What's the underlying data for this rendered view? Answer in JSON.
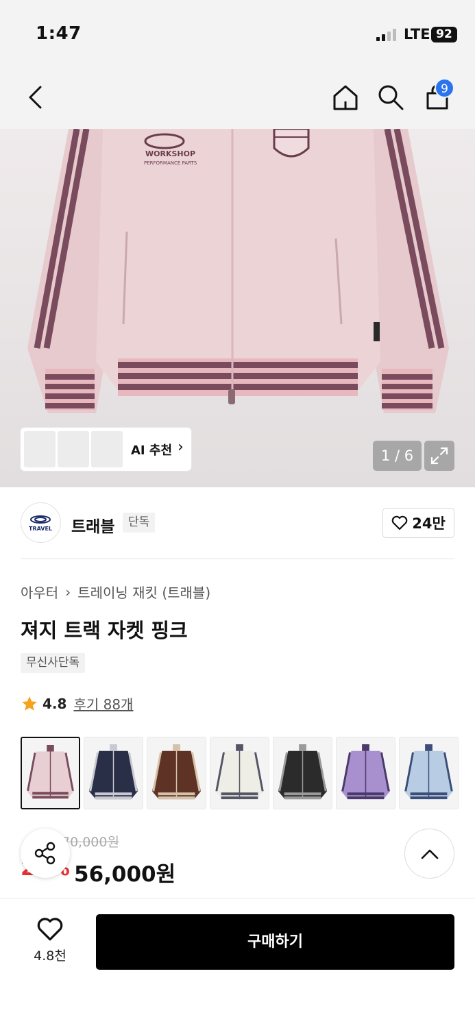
{
  "status_bar": {
    "time": "1:47",
    "network": "LTE",
    "battery": "92"
  },
  "nav": {
    "cart_count": "9"
  },
  "hero": {
    "ai_label": "AI 추천",
    "page_counter": "1 / 6"
  },
  "brand": {
    "name": "트래블",
    "tag": "단독",
    "likes": "24만",
    "logo_text": "TRAVEL"
  },
  "product": {
    "breadcrumb": [
      "아우터",
      "트레이닝 재킷 (트래블)"
    ],
    "title": "져지 트랙 자켓 핑크",
    "tag": "무신사단독",
    "rating": "4.8",
    "reviews": "후기 88개"
  },
  "colors": [
    {
      "name": "pink",
      "body": "#e8cfd3",
      "trim": "#7a4b5d"
    },
    {
      "name": "navy",
      "body": "#2a2f48",
      "trim": "#c9c9d2"
    },
    {
      "name": "brown",
      "body": "#5e3326",
      "trim": "#d6c2a8"
    },
    {
      "name": "ivory",
      "body": "#eeeee6",
      "trim": "#555566"
    },
    {
      "name": "black",
      "body": "#2b2b2b",
      "trim": "#9a9a9a"
    },
    {
      "name": "purple-model",
      "body": "#a88fcd",
      "trim": "#4a3a6a"
    },
    {
      "name": "sky-blue",
      "body": "#b8cde4",
      "trim": "#3b4d78"
    }
  ],
  "price": {
    "original": "70,000원",
    "discount": "20%",
    "sale": "56,000원"
  },
  "bottom": {
    "wish_count": "4.8천",
    "buy_label": "구매하기"
  }
}
